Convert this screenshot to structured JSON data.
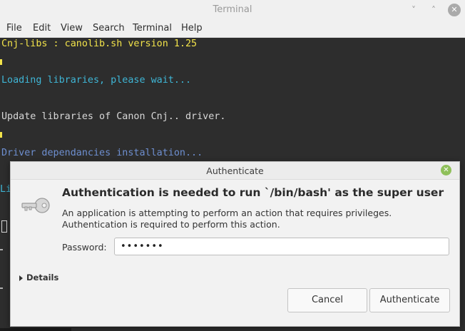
{
  "terminal": {
    "title": "Terminal",
    "menu": [
      "File",
      "Edit",
      "View",
      "Search",
      "Terminal",
      "Help"
    ],
    "lines": [
      "Cnj-libs : canolib.sh version 1.25",
      "Loading libraries, please wait...",
      "Update libraries of Canon Cnj.. driver.",
      "Driver dependancies installation...",
      "Li"
    ],
    "window_controls": {
      "minimize": "˅",
      "maximize": "˄",
      "close": "✕"
    }
  },
  "dialog": {
    "title": "Authenticate",
    "heading": "Authentication is needed to run `/bin/bash' as the super user",
    "message": "An application is attempting to perform an action that requires privileges. Authentication is required to perform this action.",
    "password_label": "Password:",
    "password_value": "•••••••",
    "details_label": "Details",
    "cancel_label": "Cancel",
    "authenticate_label": "Authenticate",
    "close_glyph": "✕"
  },
  "colors": {
    "terminal_bg": "#2d2d2d",
    "terminal_yellow": "#f2e34a",
    "terminal_cyan": "#3fb6d6",
    "terminal_blue": "#6e8fd0",
    "close_green": "#8fc05a"
  },
  "icons": [
    "key-icon",
    "chevron-down-icon",
    "chevron-up-icon",
    "close-icon",
    "expander-arrow-icon"
  ]
}
